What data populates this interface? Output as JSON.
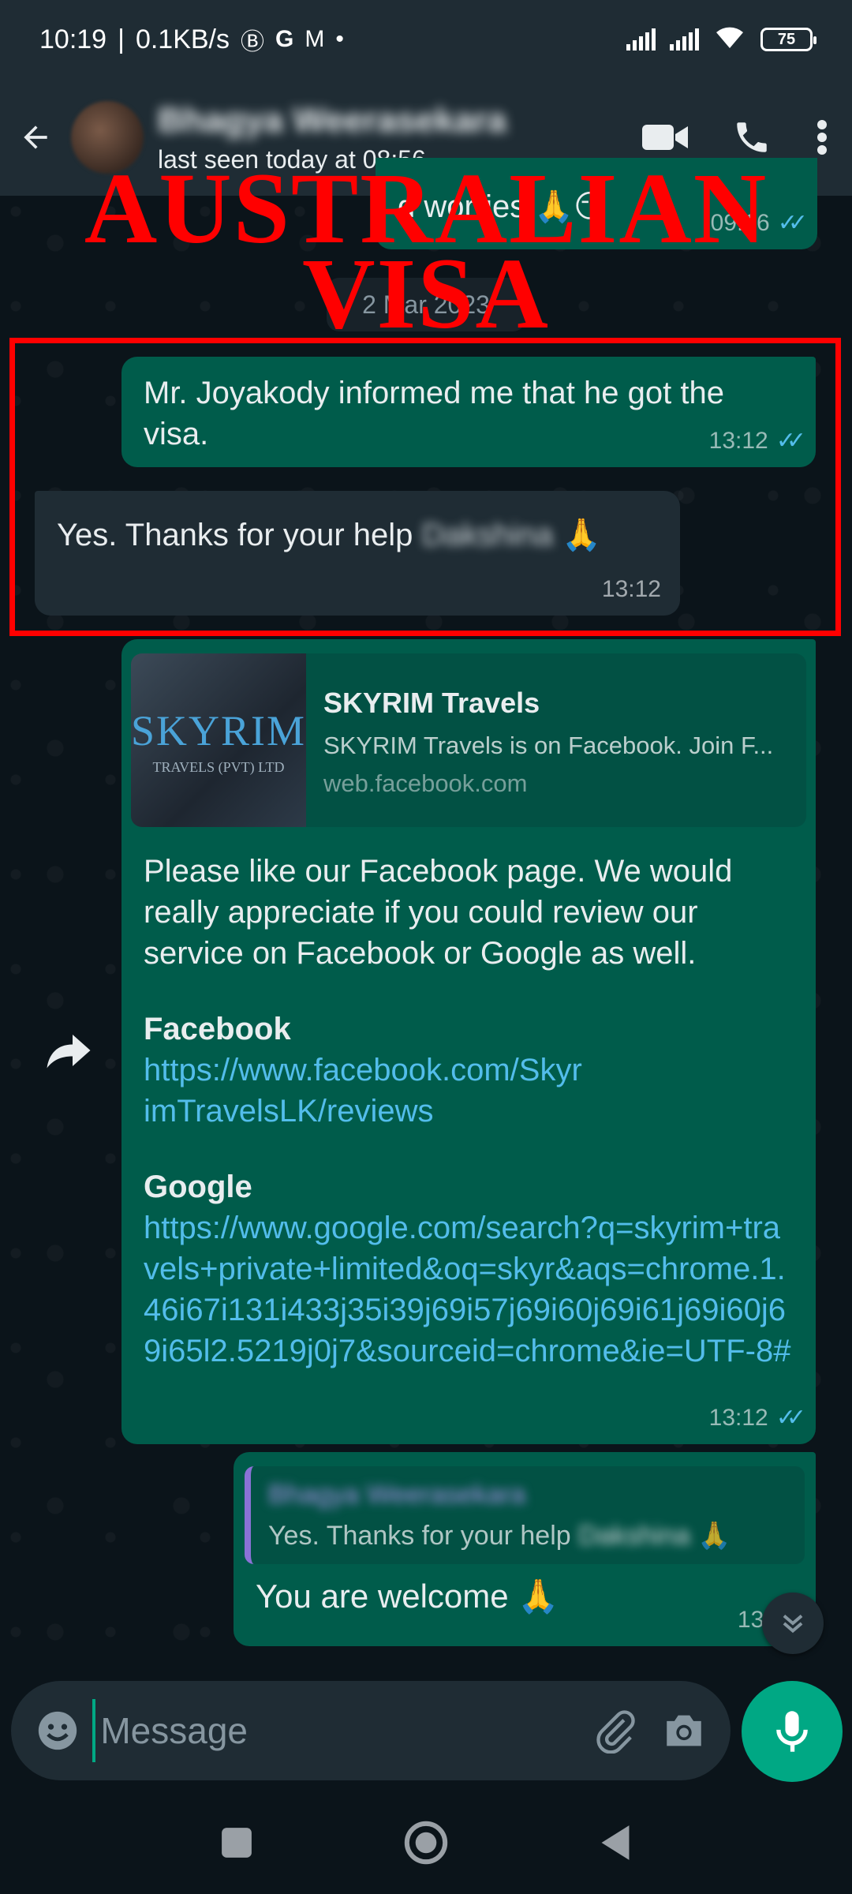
{
  "status_bar": {
    "time": "10:19",
    "speed": "0.1KB/s",
    "app_icons": [
      "b-circle-icon",
      "g-icon",
      "gmail-icon",
      "dot-icon"
    ],
    "battery": "75"
  },
  "header": {
    "contact_name": "Bhagya Weerasekara",
    "last_seen": "last seen today at 08:56"
  },
  "overlay": {
    "line1": "AUSTRALIAN",
    "line2": "VISA"
  },
  "messages": {
    "previous": {
      "text": "d worries 🙏😏",
      "time": "09:16"
    },
    "date_chip": "2 Mar 2023",
    "m1": {
      "text": "Mr. Joyakody informed me that he got the visa.",
      "time": "13:12"
    },
    "m2": {
      "text_prefix": "Yes. Thanks for your help",
      "blurred_name": "Dakshina",
      "emoji": "🙏",
      "time": "13:12"
    },
    "m3": {
      "preview_logo": "SKYRIM",
      "preview_logo_sub": "TRAVELS (PVT) LTD",
      "preview_title": "SKYRIM Travels",
      "preview_desc": "SKYRIM Travels is on Facebook. Join F...",
      "preview_domain": "web.facebook.com",
      "body": "Please like our Facebook page. We would really appreciate if you could review our service on Facebook or Google as well.",
      "facebook_label": "Facebook",
      "facebook_url": "https://www.facebook.com/SkyrimTravelsLK/reviews",
      "google_label": "Google",
      "google_url": "https://www.google.com/search?q=skyrim+travels+private+limited&oq=skyr&aqs=chrome.1.46i67i131i433j35i39j69i57j69i60j69i61j69i60j69i65l2.5219j0j7&sourceid=chrome&ie=UTF-8#",
      "time": "13:12"
    },
    "m4": {
      "quote_name": "Bhagya Weerasekara",
      "quote_text_prefix": "Yes. Thanks for your help",
      "quote_blurred": "Dakshina",
      "quote_emoji": "🙏",
      "text": "You are welcome 🙏",
      "time": "13:12"
    }
  },
  "input": {
    "placeholder": "Message"
  },
  "colors": {
    "background": "#0b141a",
    "header": "#1f2c34",
    "outgoing_bubble": "#005c4b",
    "incoming_bubble": "#1f2c34",
    "accent": "#00a884",
    "link": "#53bdeb",
    "overlay_red": "#ff0000"
  }
}
